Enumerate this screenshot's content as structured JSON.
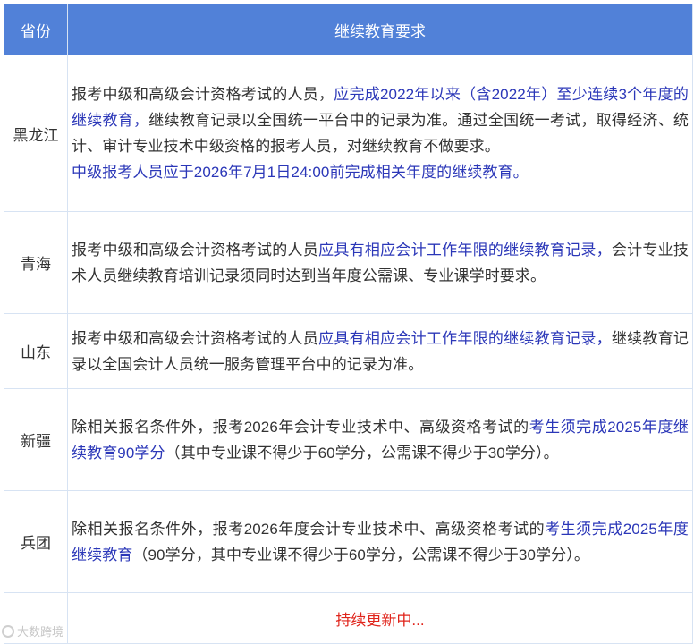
{
  "table": {
    "header": {
      "province": "省份",
      "requirement": "继续教育要求"
    },
    "rows": [
      {
        "province": "黑龙江",
        "p1_a": "报考中级和高级会计资格考试的人员，",
        "p1_b": "应完成2022年以来（含2022年）至少连续3个年度的继续教育，",
        "p1_c": "继续教育记录以全国统一平台中的记录为准。通过全国统一考试，取得经济、统计、审计专业技术中级资格的报考人员，对继续教育不做要求。",
        "p2_a": "中级",
        "p2_b": "报考人员应于2026年7月1日24:00前",
        "p2_c": "完成相关年度的继续教育。"
      },
      {
        "province": "青海",
        "a": "报考中级和高级会计资格考试的人员",
        "b": "应具有相应会计工作年限的继续教育记录，",
        "c": "会计专业技术人员继续教育培训记录须同时达到当年度公需课、专业课学时要求。"
      },
      {
        "province": "山东",
        "a": "报考中级和高级会计资格考试的人员",
        "b": "应具有相应会计工作年限的继续教育记录，",
        "c": "继续教育记录以全国会计人员统一服务管理平台中的记录为准。"
      },
      {
        "province": "新疆",
        "a": "除相关报名条件外，报考2026年会计专业技术中、高级资格考试的",
        "b": "考生须完成2025年度继续教育90学分",
        "c": "（其中专业课不得少于60学分，公需课不得少于30学分）。"
      },
      {
        "province": "兵团",
        "a": "除相关报名条件外，报考2026年度会计专业技术中、高级资格考试的",
        "b": "考生须完成2025年度继续教育",
        "c": "（90学分，其中专业课不得少于60学分，公需课不得少于30学分）。"
      }
    ],
    "status": "持续更新中..."
  },
  "corner_logo": "大数跨境",
  "colors": {
    "header_bg": "#5181d8",
    "highlight": "#2b37b8",
    "status": "#e0241b"
  }
}
